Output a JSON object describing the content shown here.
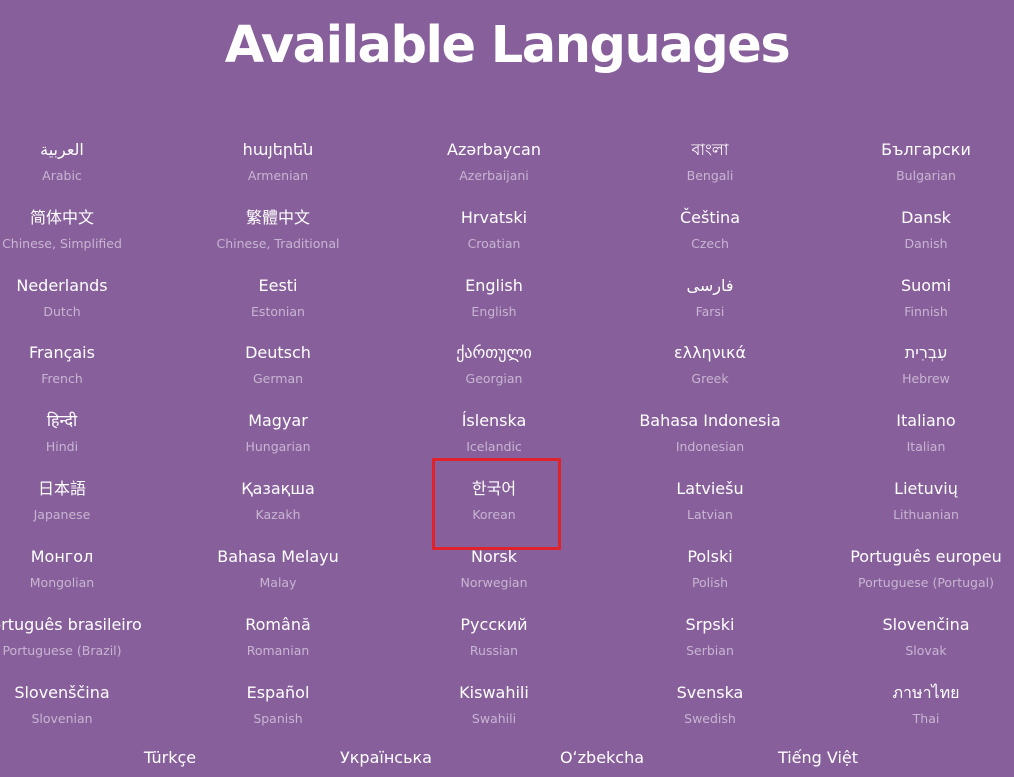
{
  "title": "Available Languages",
  "languages": [
    {
      "native": "العربية",
      "english": "Arabic"
    },
    {
      "native": "հայերեն",
      "english": "Armenian"
    },
    {
      "native": "Azərbaycan",
      "english": "Azerbaijani"
    },
    {
      "native": "বাংলা",
      "english": "Bengali"
    },
    {
      "native": "Български",
      "english": "Bulgarian"
    },
    {
      "native": "简体中文",
      "english": "Chinese, Simplified"
    },
    {
      "native": "繁體中文",
      "english": "Chinese, Traditional"
    },
    {
      "native": "Hrvatski",
      "english": "Croatian"
    },
    {
      "native": "Čeština",
      "english": "Czech"
    },
    {
      "native": "Dansk",
      "english": "Danish"
    },
    {
      "native": "Nederlands",
      "english": "Dutch"
    },
    {
      "native": "Eesti",
      "english": "Estonian"
    },
    {
      "native": "English",
      "english": "English"
    },
    {
      "native": "فارسی",
      "english": "Farsi"
    },
    {
      "native": "Suomi",
      "english": "Finnish"
    },
    {
      "native": "Français",
      "english": "French"
    },
    {
      "native": "Deutsch",
      "english": "German"
    },
    {
      "native": "ქართული",
      "english": "Georgian"
    },
    {
      "native": "ελληνικά",
      "english": "Greek"
    },
    {
      "native": "עִבְרִית",
      "english": "Hebrew"
    },
    {
      "native": "हिन्दी",
      "english": "Hindi"
    },
    {
      "native": "Magyar",
      "english": "Hungarian"
    },
    {
      "native": "Íslenska",
      "english": "Icelandic"
    },
    {
      "native": "Bahasa Indonesia",
      "english": "Indonesian"
    },
    {
      "native": "Italiano",
      "english": "Italian"
    },
    {
      "native": "日本語",
      "english": "Japanese"
    },
    {
      "native": "Қазақша",
      "english": "Kazakh"
    },
    {
      "native": "한국어",
      "english": "Korean"
    },
    {
      "native": "Latviešu",
      "english": "Latvian"
    },
    {
      "native": "Lietuvių",
      "english": "Lithuanian"
    },
    {
      "native": "Монгол",
      "english": "Mongolian"
    },
    {
      "native": "Bahasa Melayu",
      "english": "Malay"
    },
    {
      "native": "Norsk",
      "english": "Norwegian"
    },
    {
      "native": "Polski",
      "english": "Polish"
    },
    {
      "native": "Português europeu",
      "english": "Portuguese (Portugal)"
    },
    {
      "native": "Português brasileiro",
      "english": "Portuguese (Brazil)"
    },
    {
      "native": "Română",
      "english": "Romanian"
    },
    {
      "native": "Русский",
      "english": "Russian"
    },
    {
      "native": "Srpski",
      "english": "Serbian"
    },
    {
      "native": "Slovenčina",
      "english": "Slovak"
    },
    {
      "native": "Slovenščina",
      "english": "Slovenian"
    },
    {
      "native": "Español",
      "english": "Spanish"
    },
    {
      "native": "Kiswahili",
      "english": "Swahili"
    },
    {
      "native": "Svenska",
      "english": "Swedish"
    },
    {
      "native": "ภาษาไทย",
      "english": "Thai"
    }
  ],
  "bottom_languages": [
    {
      "native": "Türkçe"
    },
    {
      "native": "Українська"
    },
    {
      "native": "Oʻzbekcha"
    },
    {
      "native": "Tiếng Việt"
    }
  ],
  "colors": {
    "background": "#875f9a",
    "text_primary": "#ffffff",
    "text_secondary": "#c8b5d3",
    "highlight": "#e0222b"
  }
}
